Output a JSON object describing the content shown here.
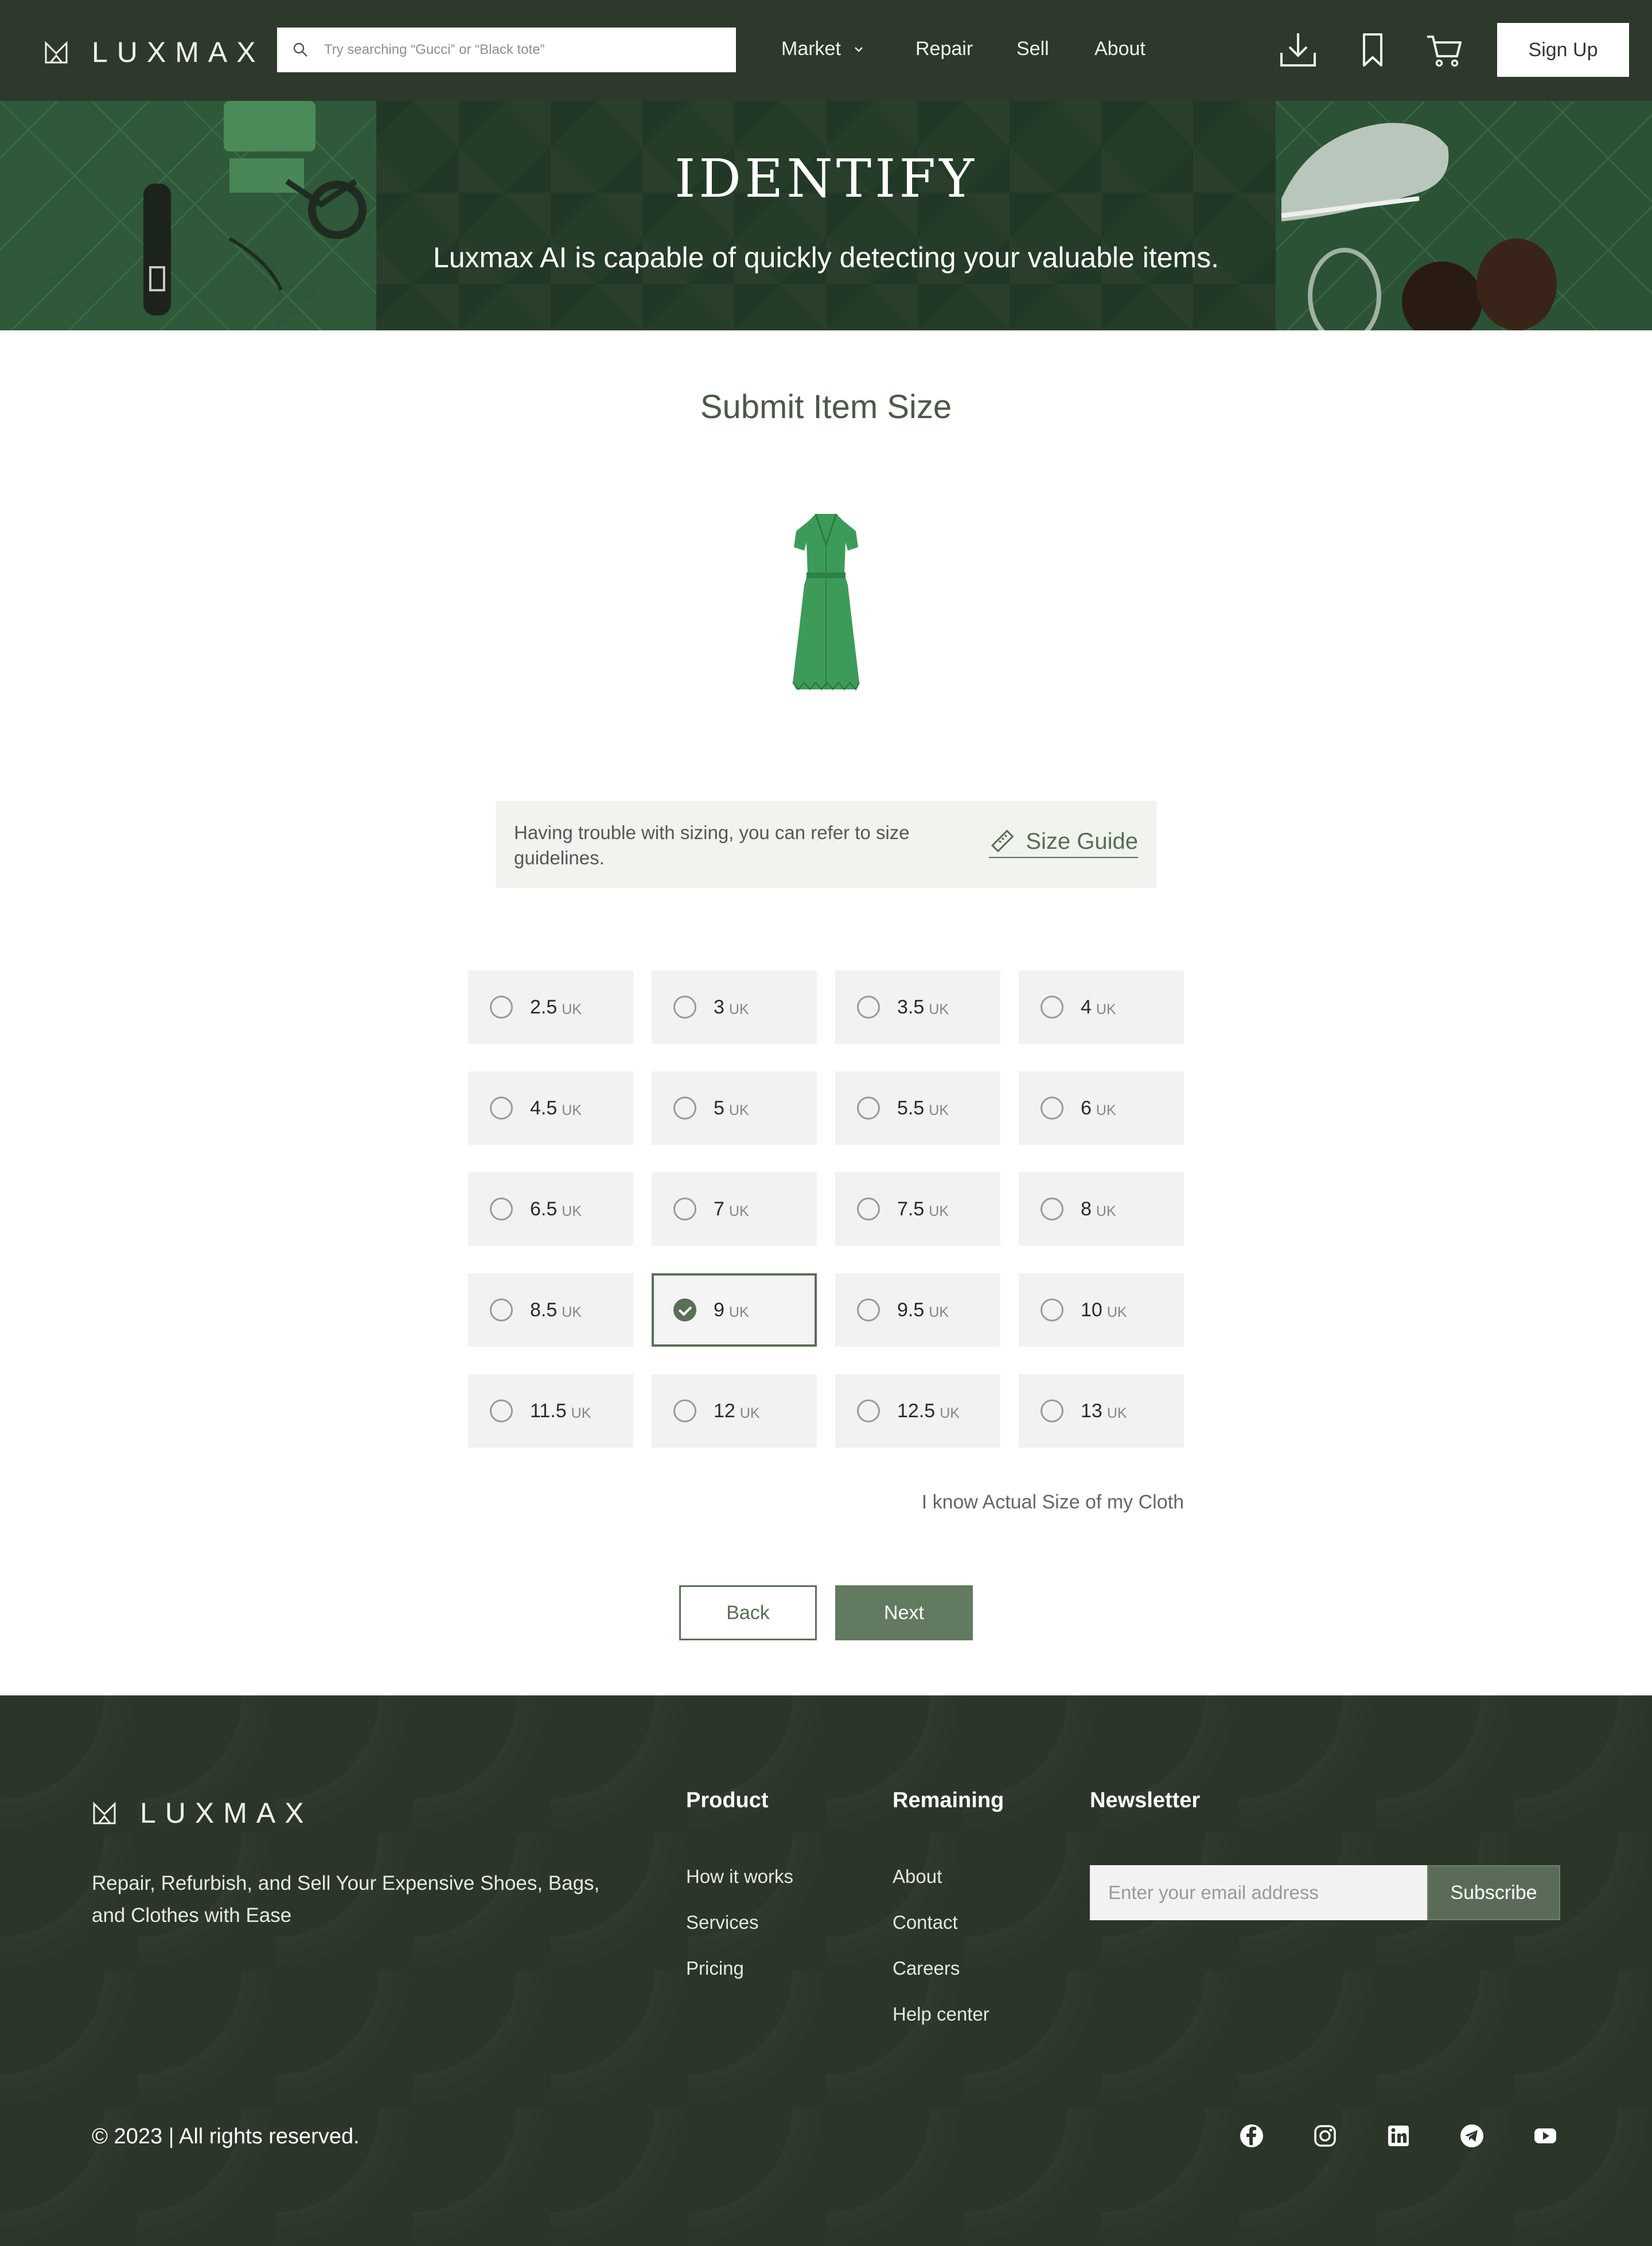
{
  "header": {
    "logo_text": "LUXMAX",
    "search_placeholder": "Try searching “Gucci” or “Black tote”",
    "nav": {
      "market": "Market",
      "repair": "Repair",
      "sell": "Sell",
      "about": "About"
    },
    "icons": [
      "download-icon",
      "bookmark-icon",
      "cart-icon"
    ],
    "signup_label": "Sign Up"
  },
  "hero": {
    "title": "IDENTIFY",
    "subtitle": "Luxmax AI is capable of quickly detecting your valuable items."
  },
  "main": {
    "title": "Submit Item Size",
    "help_text": "Having trouble with sizing, you can refer to size guidelines.",
    "size_guide_label": "Size Guide",
    "size_unit": "UK",
    "sizes": [
      {
        "value": "2.5",
        "selected": false
      },
      {
        "value": "3",
        "selected": false
      },
      {
        "value": "3.5",
        "selected": false
      },
      {
        "value": "4",
        "selected": false
      },
      {
        "value": "4.5",
        "selected": false
      },
      {
        "value": "5",
        "selected": false
      },
      {
        "value": "5.5",
        "selected": false
      },
      {
        "value": "6",
        "selected": false
      },
      {
        "value": "6.5",
        "selected": false
      },
      {
        "value": "7",
        "selected": false
      },
      {
        "value": "7.5",
        "selected": false
      },
      {
        "value": "8",
        "selected": false
      },
      {
        "value": "8.5",
        "selected": false
      },
      {
        "value": "9",
        "selected": true
      },
      {
        "value": "9.5",
        "selected": false
      },
      {
        "value": "10",
        "selected": false
      },
      {
        "value": "11.5",
        "selected": false
      },
      {
        "value": "12",
        "selected": false
      },
      {
        "value": "12.5",
        "selected": false
      },
      {
        "value": "13",
        "selected": false
      }
    ],
    "know_actual_label": "I know Actual Size of my Cloth",
    "back_label": "Back",
    "next_label": "Next"
  },
  "footer": {
    "logo_text": "LUXMAX",
    "tagline": "Repair, Refurbish, and Sell Your Expensive Shoes, Bags, and Clothes with Ease",
    "product_title": "Product",
    "product_links": [
      "How it works",
      "Services",
      "Pricing"
    ],
    "remaining_title": "Remaining",
    "remaining_links": [
      "About",
      "Contact",
      "Careers",
      "Help center"
    ],
    "newsletter_title": "Newsletter",
    "email_placeholder": "Enter your email address",
    "subscribe_label": "Subscribe",
    "copyright": "© 2023 |  All rights reserved.",
    "socials": [
      "facebook-icon",
      "instagram-icon",
      "linkedin-icon",
      "telegram-icon",
      "youtube-icon"
    ]
  },
  "colors": {
    "header_bg": "#2d3a2b",
    "accent": "#5b6f58",
    "next_button": "#627a60",
    "footer_bg": "#2b3629"
  }
}
